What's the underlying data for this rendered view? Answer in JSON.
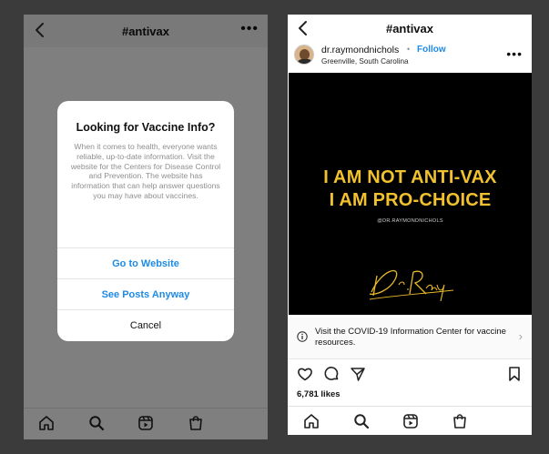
{
  "left_screen": {
    "header": {
      "title": "#antivax",
      "more_icon": "more-horizontal-icon",
      "back_icon": "chevron-left-icon"
    },
    "modal": {
      "title": "Looking for Vaccine Info?",
      "body": "When it comes to health, everyone wants reliable, up-to-date information. Visit the website for the Centers for Disease Control and Prevention. The website has information that can help answer questions you may have about vaccines.",
      "buttons": [
        {
          "label": "Go to Website"
        },
        {
          "label": "See Posts Anyway"
        },
        {
          "label": "Cancel"
        }
      ]
    },
    "nav": [
      "home-icon",
      "search-icon",
      "reels-icon",
      "shop-icon"
    ]
  },
  "right_screen": {
    "header": {
      "title": "#antivax",
      "back_icon": "chevron-left-icon"
    },
    "post": {
      "username": "dr.raymondnichols",
      "separator": "•",
      "follow_label": "Follow",
      "location": "Greenville, South Carolina",
      "image": {
        "line1": "I AM NOT ANTI-VAX",
        "line2": "I AM PRO-CHOICE",
        "handle": "@DR.RAYMONDNICHOLS",
        "signature": "Dr.Ray"
      },
      "info_banner": "Visit the COVID-19 Information Center for vaccine resources.",
      "likes": "6,781 likes"
    },
    "nav": [
      "home-icon",
      "search-icon",
      "reels-icon",
      "shop-icon"
    ]
  },
  "colors": {
    "accent_blue": "#1d8ae6",
    "post_text_yellow": "#f2c12e",
    "background": "#3b3b3b"
  }
}
